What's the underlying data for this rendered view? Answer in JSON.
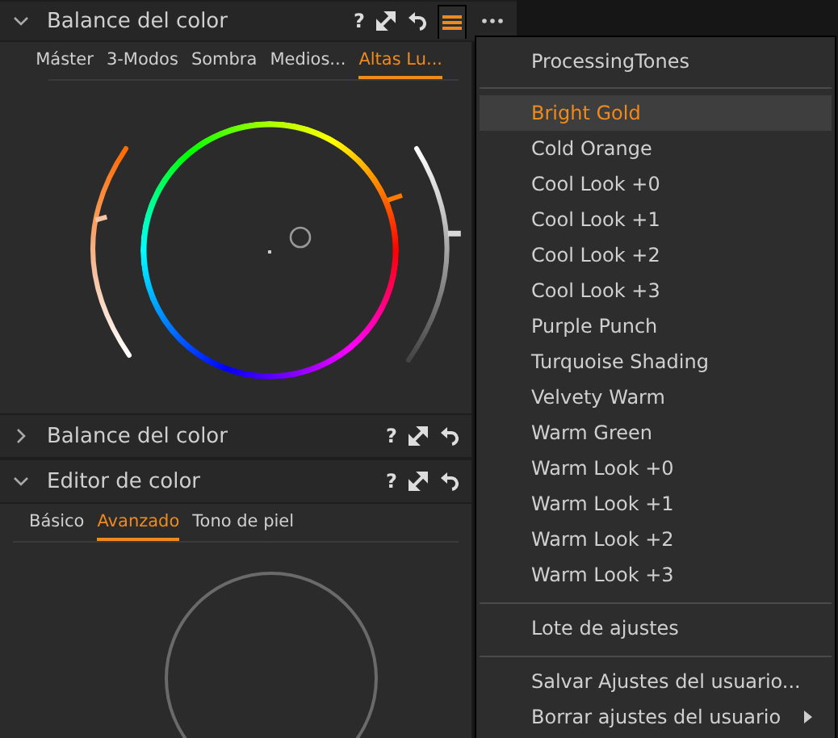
{
  "panels": [
    {
      "title": "Balance del color",
      "expanded": true,
      "help": "?",
      "tabs": [
        {
          "label": "Máster",
          "selected": false
        },
        {
          "label": "3-Modos",
          "selected": false
        },
        {
          "label": "Sombra",
          "selected": false
        },
        {
          "label": "Medios...",
          "selected": false
        },
        {
          "label": "Altas Lu...",
          "selected": true
        }
      ],
      "kind": "wheel",
      "menu_open": true,
      "saturation": {
        "level": 0.65
      },
      "brightness": {
        "level": 0.6
      }
    },
    {
      "title": "Balance del color",
      "expanded": false,
      "help": "?",
      "menu_open": false
    },
    {
      "title": "Editor de color",
      "expanded": true,
      "help": "?",
      "tabs": [
        {
          "label": "Básico",
          "selected": false
        },
        {
          "label": "Avanzado",
          "selected": true
        },
        {
          "label": "Tono de piel",
          "selected": false
        }
      ],
      "kind": "circle",
      "menu_open": false
    }
  ],
  "menu": {
    "header": "ProcessingTones",
    "sections": [
      [
        {
          "label": "Bright Gold",
          "selected": true,
          "submenu": false
        },
        {
          "label": "Cold Orange",
          "selected": false,
          "submenu": false
        },
        {
          "label": "Cool Look +0",
          "selected": false,
          "submenu": false
        },
        {
          "label": "Cool Look +1",
          "selected": false,
          "submenu": false
        },
        {
          "label": "Cool Look +2",
          "selected": false,
          "submenu": false
        },
        {
          "label": "Cool Look +3",
          "selected": false,
          "submenu": false
        },
        {
          "label": "Purple Punch",
          "selected": false,
          "submenu": false
        },
        {
          "label": "Turquoise Shading",
          "selected": false,
          "submenu": false
        },
        {
          "label": "Velvety Warm",
          "selected": false,
          "submenu": false
        },
        {
          "label": "Warm Green",
          "selected": false,
          "submenu": false
        },
        {
          "label": "Warm Look +0",
          "selected": false,
          "submenu": false
        },
        {
          "label": "Warm Look +1",
          "selected": false,
          "submenu": false
        },
        {
          "label": "Warm Look +2",
          "selected": false,
          "submenu": false
        },
        {
          "label": "Warm Look +3",
          "selected": false,
          "submenu": false
        }
      ],
      [
        {
          "label": "Lote de ajustes",
          "selected": false,
          "submenu": false
        }
      ],
      [
        {
          "label": "Salvar Ajustes del usuario...",
          "selected": false,
          "submenu": false
        },
        {
          "label": "Borrar ajustes del usuario",
          "selected": false,
          "submenu": true
        }
      ]
    ]
  }
}
